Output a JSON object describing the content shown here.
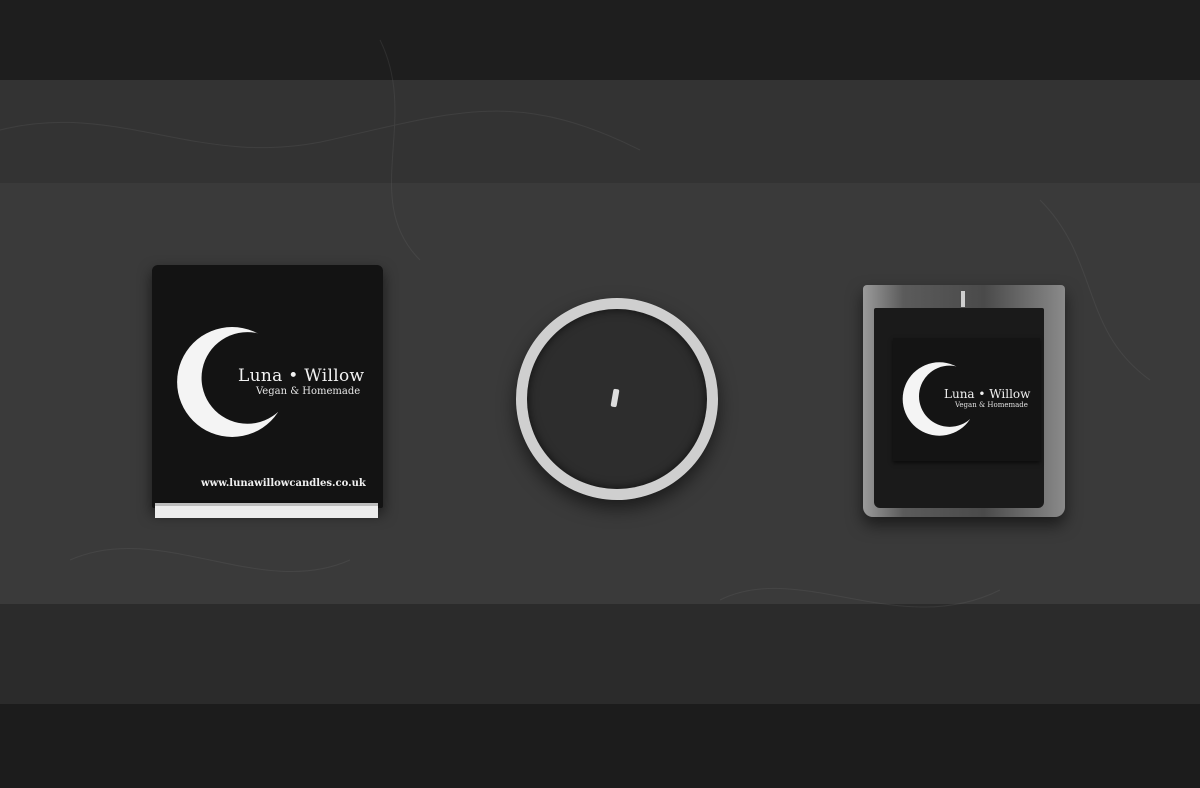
{
  "scene": "candle-branding-mockup",
  "brand": {
    "name": "Luna • Willow",
    "tagline": "Vegan & Homemade",
    "website": "www.lunawillowcandles.co.uk"
  },
  "colors": {
    "background": "#3a3a3a",
    "box": "#131313",
    "text": "#f2f2f2",
    "moon": "#f4f4f4"
  },
  "items": [
    {
      "name": "candle-box",
      "icon": "crescent-moon-icon"
    },
    {
      "name": "candle-top-view"
    },
    {
      "name": "glass-candle-jar",
      "icon": "crescent-moon-icon"
    }
  ]
}
